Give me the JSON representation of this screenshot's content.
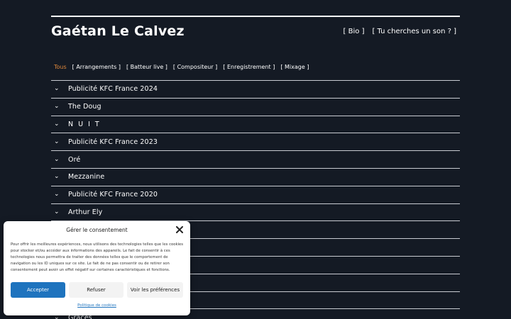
{
  "header": {
    "title": "Gaétan Le Calvez",
    "nav": [
      "[ Bio ]",
      "[ Tu cherches un son ? ]"
    ]
  },
  "filters": {
    "active": "Tous",
    "items": [
      "[ Arrangements ]",
      "[ Batteur live ]",
      "[ Compositeur ]",
      "[ Enregistrement ]",
      "[ Mixage ]"
    ]
  },
  "projects": [
    "Publicité KFC France 2024",
    "The Doug",
    "N U I T",
    "Publicité KFC France 2023",
    "Oré",
    "Mezzanine",
    "Publicité KFC France 2020",
    "Arthur Ely",
    "",
    "",
    "",
    "",
    "",
    "Grâces"
  ],
  "chevron_icon": "⌄",
  "consent": {
    "title": "Gérer le consentement",
    "text": "Pour offrir les meilleures expériences, nous utilisons des technologies telles que les cookies pour stocker et/ou accéder aux informations des appareils. Le fait de consentir à ces technologies nous permettra de traiter des données telles que le comportement de navigation ou les ID uniques sur ce site. Le fait de ne pas consentir ou de retirer son consentement peut avoir un effet négatif sur certaines caractéristiques et fonctions.",
    "accept": "Accepter",
    "refuse": "Refuser",
    "preferences": "Voir les préférences",
    "policy_link": "Politique de cookies"
  },
  "colors": {
    "background": "#141a24",
    "active_filter": "#e0883a",
    "accept_button": "#1e73be"
  }
}
